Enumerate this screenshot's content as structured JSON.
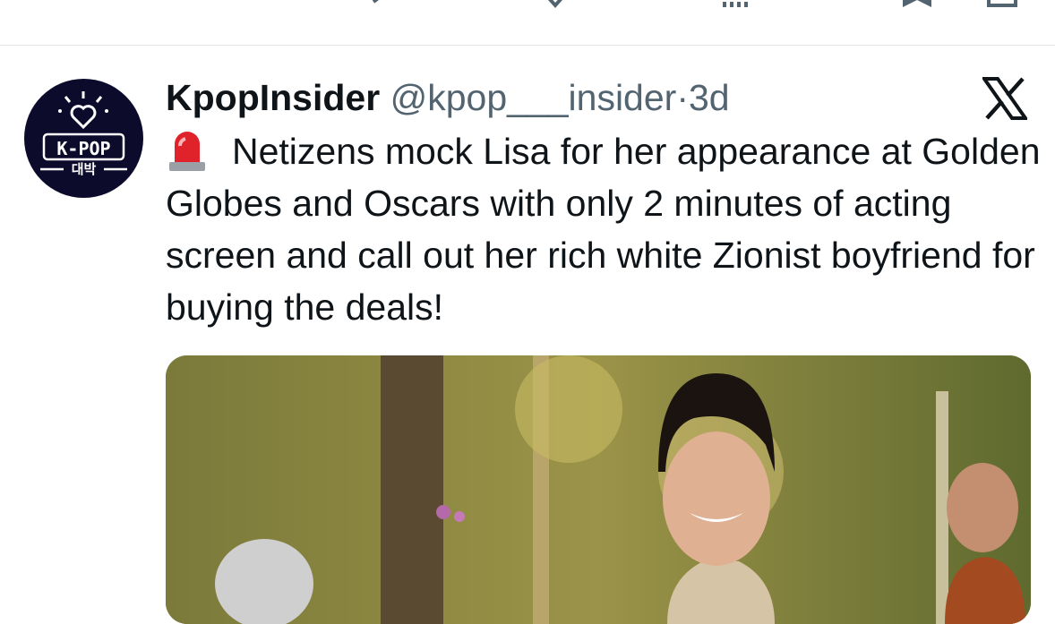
{
  "tweet": {
    "author": {
      "display_name": "KpopInsider",
      "handle": "@kpop___insider",
      "avatar_text": "K-POP",
      "avatar_subtext": "대박"
    },
    "separator": "·",
    "time_ago": "3d",
    "text": "Netizens mock Lisa for her appearance at Golden Globes and Oscars with only 2 minutes of acting screen and call out her rich white Zionist boyfriend for buying the deals!"
  },
  "icons": {
    "action_bar": [
      "reply-icon",
      "repost-icon",
      "like-icon",
      "views-icon",
      "bookmark-icon",
      "share-icon"
    ],
    "platform": "x-logo-icon",
    "emoji": "siren-icon"
  },
  "colors": {
    "text_primary": "#0f1419",
    "text_secondary": "#536471",
    "divider": "#e1e6ea",
    "avatar_bg": "#0d0b2b"
  }
}
